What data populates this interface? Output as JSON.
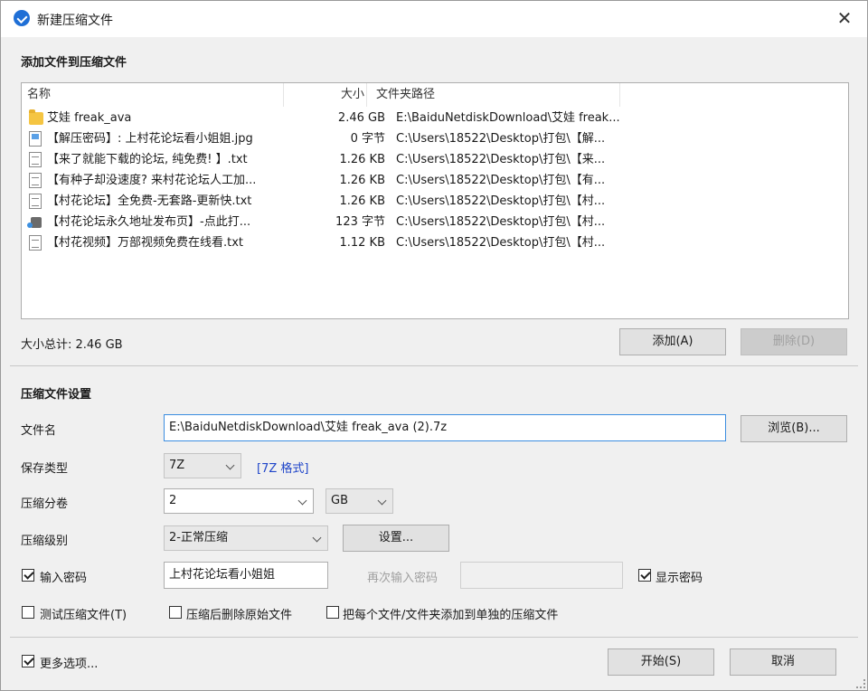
{
  "window": {
    "title": "新建压缩文件",
    "close_glyph": "✕"
  },
  "add_section": {
    "title": "添加文件到压缩文件"
  },
  "file_list": {
    "columns": {
      "name": "名称",
      "size": "大小",
      "path": "文件夹路径"
    },
    "rows": [
      {
        "icon": "folder-icon",
        "name": "艾娃 freak_ava",
        "size": "2.46 GB",
        "path": "E:\\BaiduNetdiskDownload\\艾娃 freak..."
      },
      {
        "icon": "image-file-icon",
        "name": "【解压密码】: 上村花论坛看小姐姐.jpg",
        "size": "0 字节",
        "path": "C:\\Users\\18522\\Desktop\\打包\\【解..."
      },
      {
        "icon": "text-file-icon",
        "name": "【来了就能下载的论坛, 纯免费! 】.txt",
        "size": "1.26 KB",
        "path": "C:\\Users\\18522\\Desktop\\打包\\【来..."
      },
      {
        "icon": "text-file-icon",
        "name": "【有种子却没速度? 来村花论坛人工加...",
        "size": "1.26 KB",
        "path": "C:\\Users\\18522\\Desktop\\打包\\【有..."
      },
      {
        "icon": "text-file-icon",
        "name": "【村花论坛】全免费-无套路-更新快.txt",
        "size": "1.26 KB",
        "path": "C:\\Users\\18522\\Desktop\\打包\\【村..."
      },
      {
        "icon": "url-shortcut-icon",
        "name": "【村花论坛永久地址发布页】-点此打...",
        "size": "123 字节",
        "path": "C:\\Users\\18522\\Desktop\\打包\\【村..."
      },
      {
        "icon": "text-file-icon",
        "name": "【村花视频】万部视频免费在线看.txt",
        "size": "1.12 KB",
        "path": "C:\\Users\\18522\\Desktop\\打包\\【村..."
      }
    ]
  },
  "summary": {
    "total_size": "大小总计: 2.46 GB",
    "add_button": "添加(A)",
    "delete_button": "删除(D)"
  },
  "settings": {
    "title": "压缩文件设置",
    "filename_label": "文件名",
    "filename_value": "E:\\BaiduNetdiskDownload\\艾娃 freak_ava (2).7z",
    "browse_button": "浏览(B)...",
    "type_label": "保存类型",
    "type_value": "7Z",
    "type_format_link": "[7Z 格式]",
    "split_label": "压缩分卷",
    "split_value": "2",
    "split_unit": "GB",
    "level_label": "压缩级别",
    "level_value": "2-正常压缩",
    "settings_button": "设置...",
    "password_checkbox_label": "输入密码",
    "password_checked": true,
    "password_value": "上村花论坛看小姐姐",
    "repeat_password_label": "再次输入密码",
    "repeat_password_value": "",
    "show_password_label": "显示密码",
    "show_password_checked": true,
    "test_archive_label": "测试压缩文件(T)",
    "test_archive_checked": false,
    "delete_after_label": "压缩后删除原始文件",
    "delete_after_checked": false,
    "separate_archives_label": "把每个文件/文件夹添加到单独的压缩文件",
    "separate_archives_checked": false
  },
  "footer": {
    "more_options_label": "更多选项...",
    "more_options_checked": true,
    "start_button": "开始(S)",
    "cancel_button": "取消"
  },
  "colors": {
    "accent": "#1f6fd6",
    "link": "#1f45c9",
    "background": "#f0f0f0"
  }
}
